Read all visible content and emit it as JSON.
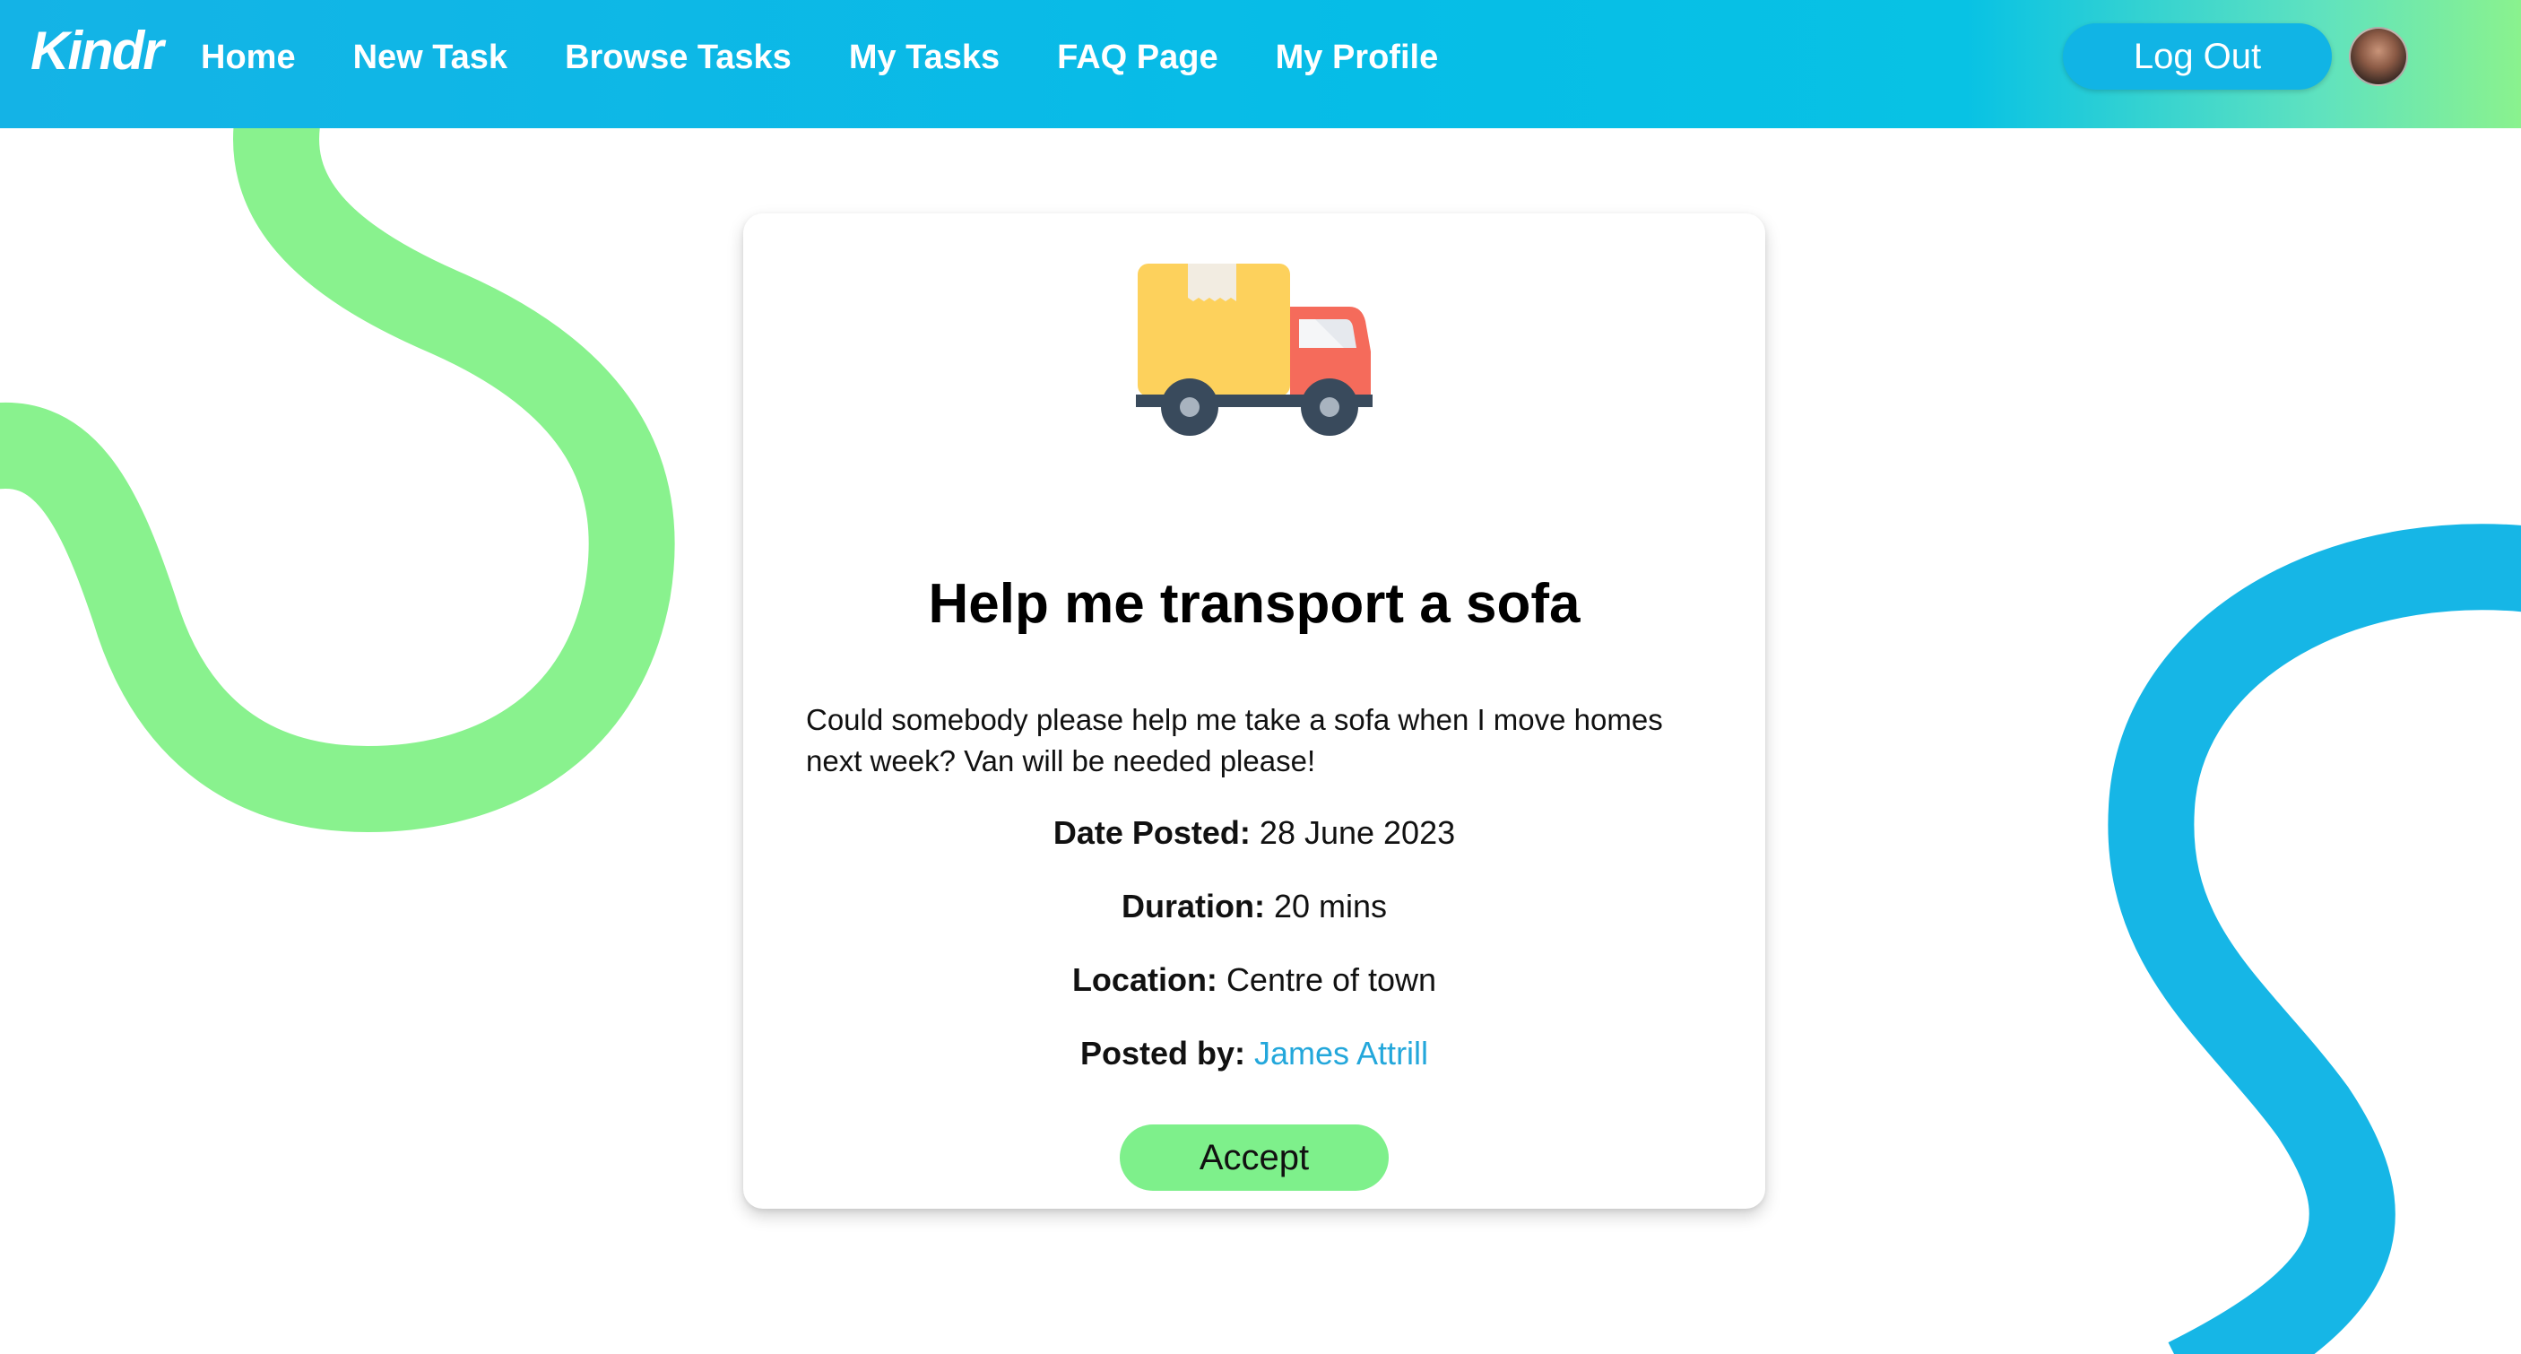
{
  "header": {
    "logo_text": "Kindr",
    "nav": [
      "Home",
      "New Task",
      "Browse Tasks",
      "My Tasks",
      "FAQ Page",
      "My Profile"
    ],
    "logout_label": "Log Out"
  },
  "task": {
    "icon": "delivery-truck-icon",
    "title": "Help me transport a sofa",
    "description": "Could somebody please help me take a sofa when I move homes next week? Van will be needed please!",
    "date_label": "Date Posted:",
    "date_value": "28 June 2023",
    "duration_label": "Duration:",
    "duration_value": "20 mins",
    "location_label": "Location:",
    "location_value": "Centre of town",
    "posted_by_label": "Posted by:",
    "posted_by_value": "James Attrill",
    "accept_label": "Accept"
  },
  "colors": {
    "nav_gradient_start": "#14b3e6",
    "nav_gradient_end": "#8af28e",
    "accent_green": "#7ef08b",
    "accent_blue": "#16b6e6",
    "link_blue": "#23a7db"
  }
}
